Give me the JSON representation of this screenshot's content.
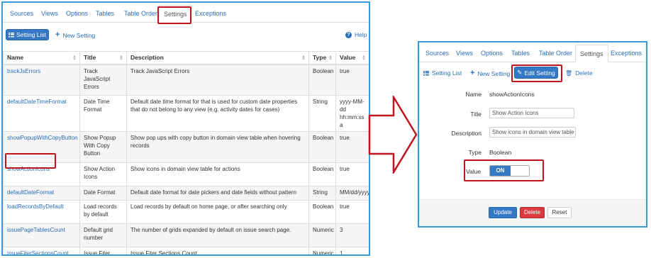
{
  "left": {
    "tabs": [
      "Sources",
      "Views",
      "Options",
      "Tables",
      "Table Order",
      "Settings",
      "Exceptions"
    ],
    "active_tab": "Settings",
    "toolbar": {
      "setting_list": "Setting List",
      "new_setting": "New Setting",
      "help": "Help"
    },
    "table": {
      "headers": [
        "Name",
        "Title",
        "Description",
        "Type",
        "Value"
      ],
      "rows": [
        {
          "name": "trackJsErrors",
          "title": "Track JavaScript Errors",
          "description": "Track JavaScript Errors",
          "type": "Boolean",
          "value": "true"
        },
        {
          "name": "defaultDateTimeFormat",
          "title": "Date Time Format",
          "description": "Default date time format for that is used for custom date properties that do not belong to any view (e.g. activity dates for cases)",
          "type": "String",
          "value": "yyyy-MM-dd hh:mm:ss a"
        },
        {
          "name": "showPopupWithCopyButton",
          "title": "Show Popup With Copy Button",
          "description": "Show pop ups with copy button in domain view table when hovering records",
          "type": "Boolean",
          "value": "true"
        },
        {
          "name": "showActionIcons",
          "title": "Show Action Icons",
          "description": "Show icons in domain view table for actions",
          "type": "Boolean",
          "value": "true"
        },
        {
          "name": "defaultDateFormat",
          "title": "Date Format",
          "description": "Default date format for date pickers and date fields without pattern",
          "type": "String",
          "value": "MM/dd/yyyy"
        },
        {
          "name": "loadRecordsByDefault",
          "title": "Load records by default",
          "description": "Load records by default on home page, or after searching only",
          "type": "Boolean",
          "value": "true"
        },
        {
          "name": "issuePageTablesCount",
          "title": "Default grid number",
          "description": "The number of grids expanded by default on issue search page.",
          "type": "Numeric",
          "value": "3"
        },
        {
          "name": "issueFiterSectionsCount",
          "title": "Issue Fiter Sections Count",
          "description": "Issue Fiter Sections Count",
          "type": "Numeric",
          "value": "1"
        }
      ]
    }
  },
  "right": {
    "tabs": [
      "Sources",
      "Views",
      "Options",
      "Tables",
      "Table Order",
      "Settings",
      "Exceptions"
    ],
    "active_tab": "Settings",
    "toolbar": {
      "setting_list": "Setting List",
      "new_setting": "New Setting",
      "edit_setting": "Edit Setting",
      "delete": "Delete"
    },
    "form": {
      "name_label": "Name",
      "name_value": "showActionIcons",
      "title_label": "Title",
      "title_value": "Show Action Icons",
      "description_label": "Description",
      "description_value": "Show icons in domain view table",
      "type_label": "Type",
      "type_value": "Boolean",
      "value_label": "Value",
      "toggle_on": "ON"
    },
    "footer": {
      "update": "Update",
      "delete": "Delete",
      "reset": "Reset"
    }
  },
  "colors": {
    "accent": "#3478c6",
    "highlight": "#c0151e",
    "danger": "#d9393f",
    "frame": "#3a9ad9"
  }
}
